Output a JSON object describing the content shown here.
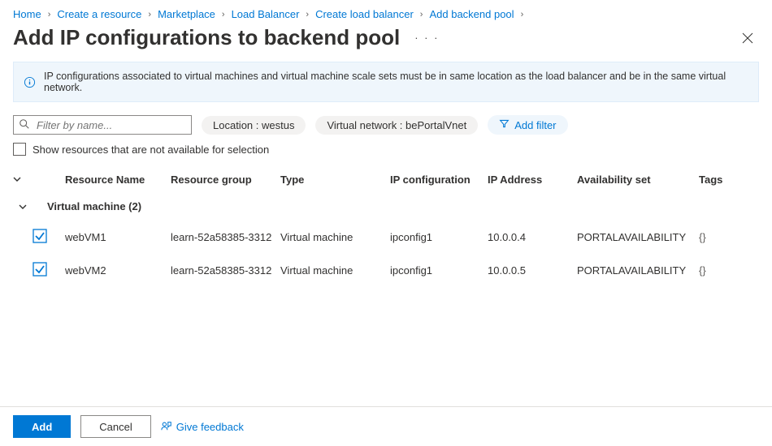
{
  "breadcrumbs": [
    "Home",
    "Create a resource",
    "Marketplace",
    "Load Balancer",
    "Create load balancer",
    "Add backend pool"
  ],
  "header": {
    "title": "Add IP configurations to backend pool",
    "more": "· · ·"
  },
  "info_bar": {
    "message": "IP configurations associated to virtual machines and virtual machine scale sets must be in same location as the load balancer and be in the same virtual network."
  },
  "toolbar": {
    "search_placeholder": "Filter by name...",
    "location_pill": "Location : westus",
    "vnet_pill": "Virtual network : bePortalVnet",
    "add_filter_label": "Add filter"
  },
  "show_unavailable_label": "Show resources that are not available for selection",
  "columns": {
    "resource_name": "Resource Name",
    "resource_group": "Resource group",
    "type": "Type",
    "ip_config": "IP configuration",
    "ip_address": "IP Address",
    "availability_set": "Availability set",
    "tags": "Tags"
  },
  "group": {
    "label": "Virtual machine (2)"
  },
  "rows": [
    {
      "name": "webVM1",
      "rg": "learn-52a58385-3312",
      "type": "Virtual machine",
      "ipconfig": "ipconfig1",
      "ip": "10.0.0.4",
      "avset": "PORTALAVAILABILITY",
      "tags": "{}"
    },
    {
      "name": "webVM2",
      "rg": "learn-52a58385-3312",
      "type": "Virtual machine",
      "ipconfig": "ipconfig1",
      "ip": "10.0.0.5",
      "avset": "PORTALAVAILABILITY",
      "tags": "{}"
    }
  ],
  "footer": {
    "add_label": "Add",
    "cancel_label": "Cancel",
    "feedback_label": "Give feedback"
  }
}
